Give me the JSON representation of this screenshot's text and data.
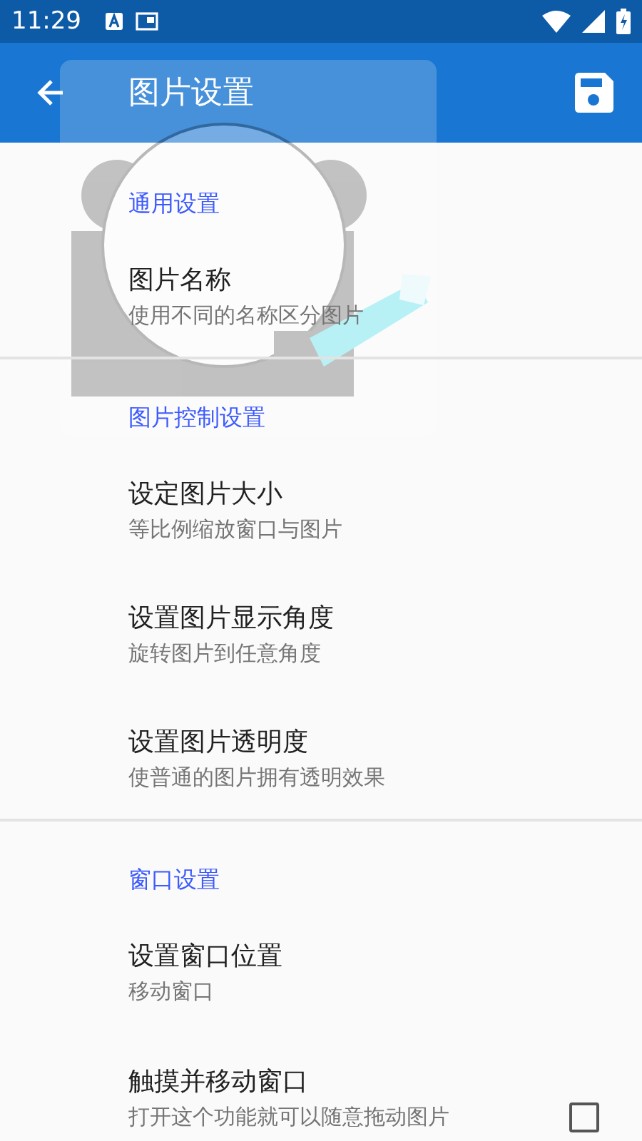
{
  "status_bar": {
    "time": "11:29"
  },
  "app_bar": {
    "title": "图片设置"
  },
  "sections": [
    {
      "header": "通用设置",
      "items": [
        {
          "kind": "plain",
          "title": "图片名称",
          "summary": "使用不同的名称区分图片"
        }
      ]
    },
    {
      "header": "图片控制设置",
      "items": [
        {
          "kind": "plain",
          "title": "设定图片大小",
          "summary": "等比例缩放窗口与图片"
        },
        {
          "kind": "plain",
          "title": "设置图片显示角度",
          "summary": "旋转图片到任意角度"
        },
        {
          "kind": "plain",
          "title": "设置图片透明度",
          "summary": "使普通的图片拥有透明效果"
        }
      ]
    },
    {
      "header": "窗口设置",
      "items": [
        {
          "kind": "plain",
          "title": "设置窗口位置",
          "summary": "移动窗口"
        },
        {
          "kind": "checkbox",
          "title": "触摸并移动窗口",
          "summary": "打开这个功能就可以随意拖动图片",
          "checked": false
        }
      ]
    }
  ]
}
